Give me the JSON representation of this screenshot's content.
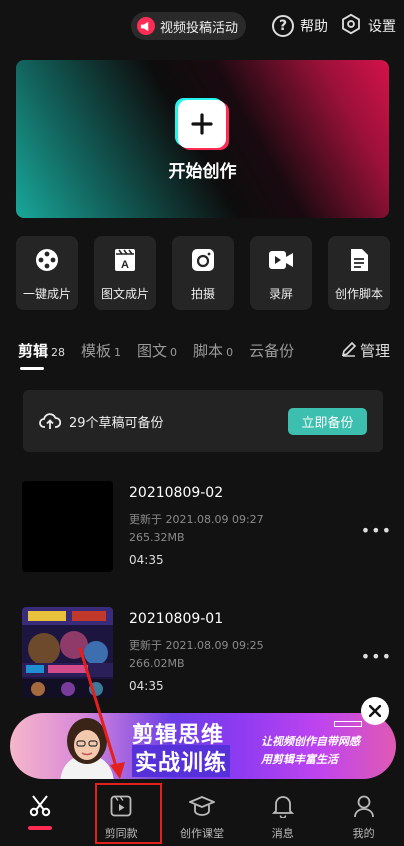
{
  "topbar": {
    "activity_label": "视频投稿活动",
    "help_label": "帮助",
    "settings_label": "设置"
  },
  "hero": {
    "label": "开始创作"
  },
  "tools": [
    {
      "label": "一键成片",
      "icon": "film-reel-icon"
    },
    {
      "label": "图文成片",
      "icon": "text-clapper-icon"
    },
    {
      "label": "拍摄",
      "icon": "camera-icon"
    },
    {
      "label": "录屏",
      "icon": "screen-record-icon"
    },
    {
      "label": "创作脚本",
      "icon": "script-icon"
    }
  ],
  "tabs": [
    {
      "name": "剪辑",
      "count": "28",
      "active": true
    },
    {
      "name": "模板",
      "count": "1"
    },
    {
      "name": "图文",
      "count": "0"
    },
    {
      "name": "脚本",
      "count": "0"
    },
    {
      "name": "云备份",
      "count": ""
    }
  ],
  "manage_label": "管理",
  "backup": {
    "text": "29个草稿可备份",
    "button": "立即备份"
  },
  "drafts": [
    {
      "title": "20210809-02",
      "updated": "更新于 2021.08.09 09:27",
      "size": "265.32MB",
      "duration": "04:35"
    },
    {
      "title": "20210809-01",
      "updated": "更新于 2021.08.09 09:25",
      "size": "266.02MB",
      "duration": "04:35"
    }
  ],
  "ad": {
    "headline1": "剪辑思维",
    "headline2": "实战训练",
    "slogan1": "让视频创作自带网感",
    "slogan2": "用剪辑丰富生活"
  },
  "nav": [
    {
      "label": "",
      "icon": "scissors-icon",
      "active": true
    },
    {
      "label": "剪同款",
      "icon": "play-template-icon"
    },
    {
      "label": "创作课堂",
      "icon": "graduation-cap-icon"
    },
    {
      "label": "消息",
      "icon": "bell-icon"
    },
    {
      "label": "我的",
      "icon": "user-icon"
    }
  ],
  "colors": {
    "accent": "#fe2c55",
    "teal": "#3cbfae",
    "background": "#121212",
    "highlight": "#e3201b"
  }
}
